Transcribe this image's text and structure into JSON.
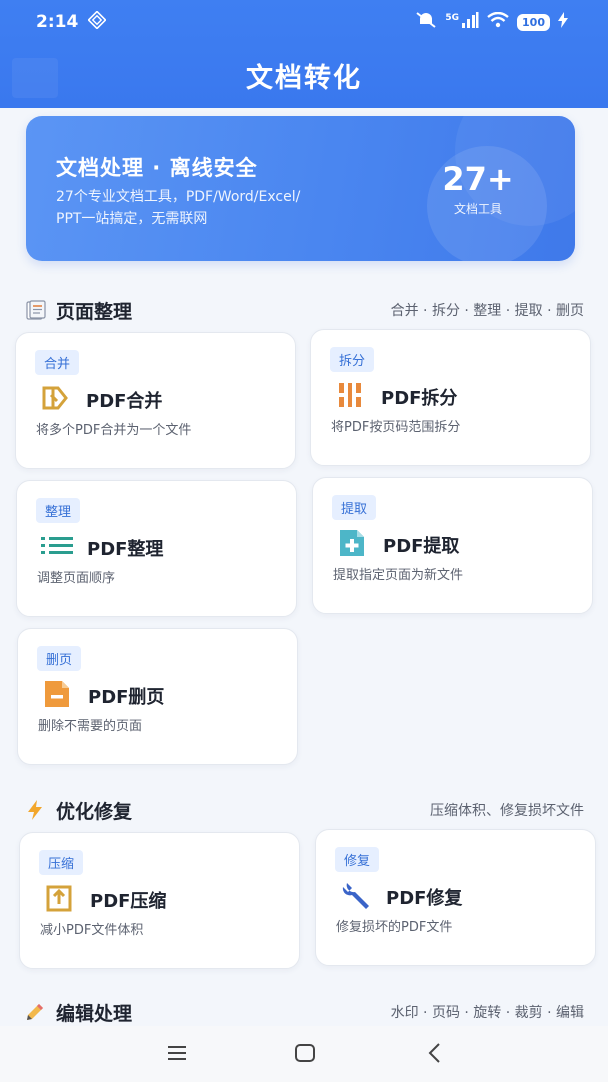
{
  "status_bar": {
    "time": "2:14",
    "network": "5G",
    "battery": "100"
  },
  "header": {
    "title": "文档转化"
  },
  "banner": {
    "title": "文档处理 · 离线安全",
    "desc_line1": "27个专业文档工具，PDF/Word/Excel/",
    "desc_line2": "PPT一站搞定，无需联网",
    "count": "27+",
    "count_label": "文档工具"
  },
  "sections": {
    "page_organize": {
      "title": "页面整理",
      "subtitle": "合并 · 拆分 · 整理 · 提取 · 删页",
      "cards": [
        {
          "tag": "合并",
          "name": "PDF合并",
          "desc": "将多个PDF合并为一个文件",
          "icon": "merge-icon"
        },
        {
          "tag": "拆分",
          "name": "PDF拆分",
          "desc": "将PDF按页码范围拆分",
          "icon": "split-icon"
        },
        {
          "tag": "整理",
          "name": "PDF整理",
          "desc": "调整页面顺序",
          "icon": "list-icon"
        },
        {
          "tag": "提取",
          "name": "PDF提取",
          "desc": "提取指定页面为新文件",
          "icon": "extract-icon"
        },
        {
          "tag": "删页",
          "name": "PDF删页",
          "desc": "删除不需要的页面",
          "icon": "delete-page-icon"
        }
      ]
    },
    "optimize": {
      "title": "优化修复",
      "subtitle": "压缩体积、修复损坏文件",
      "cards": [
        {
          "tag": "压缩",
          "name": "PDF压缩",
          "desc": "减小PDF文件体积",
          "icon": "compress-icon"
        },
        {
          "tag": "修复",
          "name": "PDF修复",
          "desc": "修复损坏的PDF文件",
          "icon": "wrench-icon"
        }
      ]
    },
    "edit": {
      "title": "编辑处理",
      "subtitle": "水印 · 页码 · 旋转 · 裁剪 · 编辑"
    }
  },
  "colors": {
    "primary": "#3f7ff2",
    "tag_bg": "#e6efff",
    "tag_text": "#3670d6",
    "icon_gold": "#d4a23a",
    "icon_orange": "#e8893c",
    "icon_teal": "#2a9d8f",
    "icon_cyan": "#4db6c8",
    "icon_blue": "#3a64c8"
  }
}
